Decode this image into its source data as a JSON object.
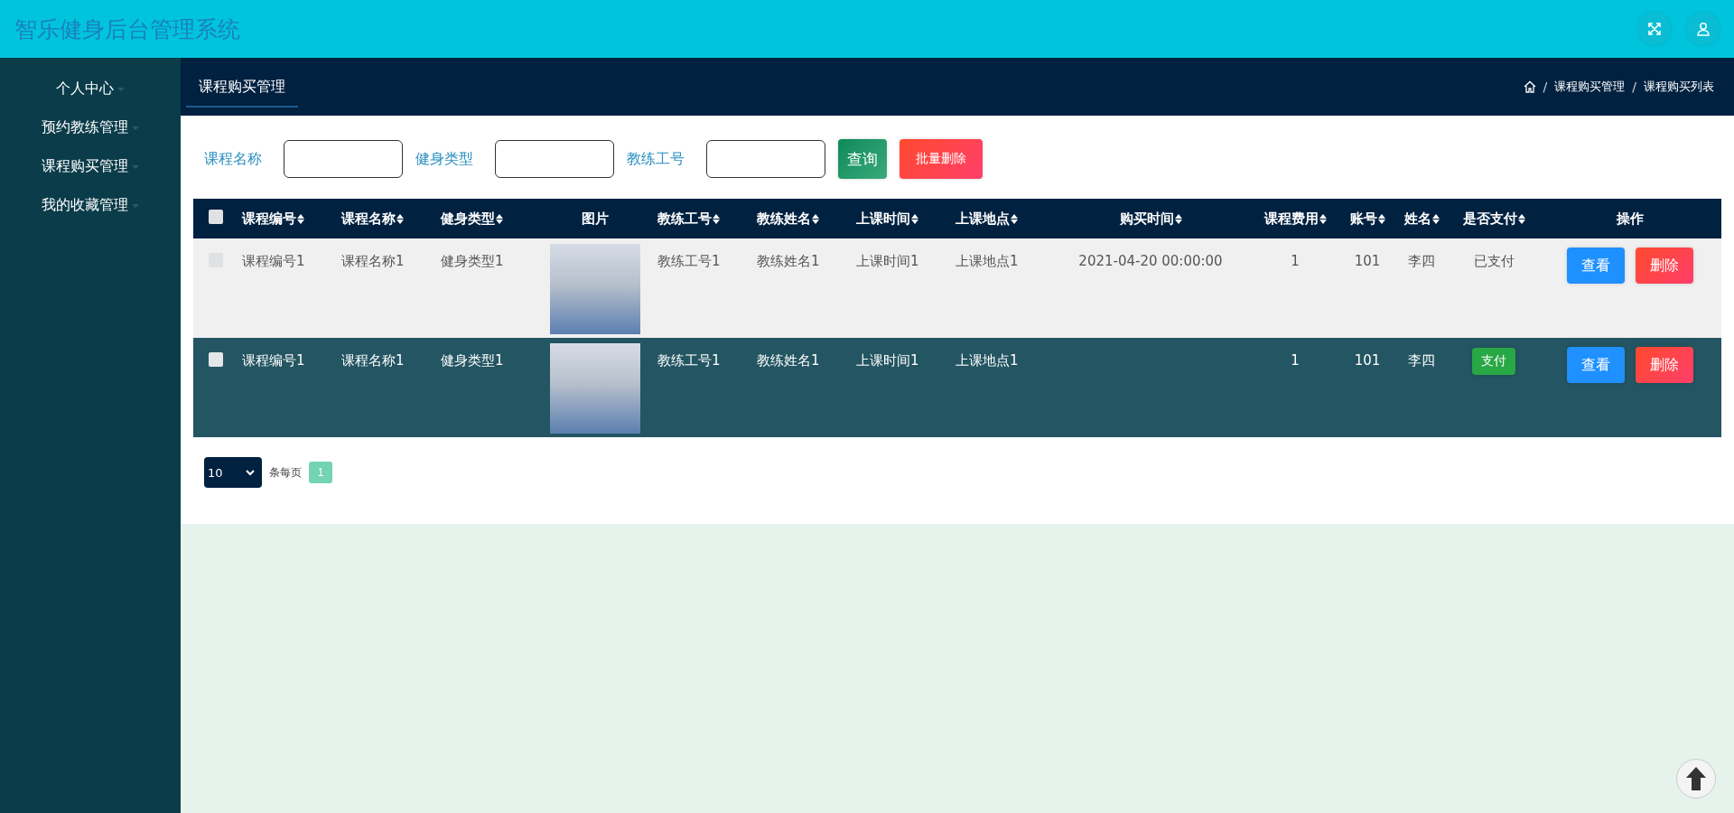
{
  "header": {
    "title": "智乐健身后台管理系统"
  },
  "sidebar": {
    "items": [
      {
        "label": "个人中心"
      },
      {
        "label": "预约教练管理"
      },
      {
        "label": "课程购买管理"
      },
      {
        "label": "我的收藏管理"
      }
    ]
  },
  "tab": {
    "label": "课程购买管理"
  },
  "breadcrumb": [
    {
      "kind": "separator",
      "label": "/"
    },
    {
      "kind": "link",
      "label": "课程购买管理"
    },
    {
      "kind": "separator",
      "label": "/"
    },
    {
      "kind": "link",
      "label": "课程购买列表"
    }
  ],
  "search": {
    "fields": [
      {
        "label": "课程名称"
      },
      {
        "label": "健身类型"
      },
      {
        "label": "教练工号"
      }
    ],
    "query_button": "查询",
    "batch_delete_button": "批量删除"
  },
  "table": {
    "select_all": {
      "checked": false
    },
    "columns": [
      {
        "label": "课程编号",
        "sortable": true
      },
      {
        "label": "课程名称",
        "sortable": true
      },
      {
        "label": "健身类型",
        "sortable": true
      },
      {
        "label": "图片",
        "sortable": false
      },
      {
        "label": "教练工号",
        "sortable": true
      },
      {
        "label": "教练姓名",
        "sortable": true
      },
      {
        "label": "上课时间",
        "sortable": true
      },
      {
        "label": "上课地点",
        "sortable": true
      },
      {
        "label": "购买时间",
        "sortable": true
      },
      {
        "label": "课程费用",
        "sortable": true
      },
      {
        "label": "账号",
        "sortable": true
      },
      {
        "label": "姓名",
        "sortable": true
      },
      {
        "label": "是否支付",
        "sortable": true
      },
      {
        "label": "操作",
        "sortable": false
      }
    ],
    "rows": [
      {
        "selected": false,
        "checked": false,
        "cells": [
          "课程编号1",
          "课程名称1",
          "健身类型1",
          "",
          "教练工号1",
          "教练姓名1",
          "上课时间1",
          "上课地点1",
          "2021-04-20 00:00:00",
          "1",
          "101",
          "李四"
        ],
        "payment": {
          "kind": "text",
          "label": "已支付"
        },
        "actions": [
          "查看",
          "删除"
        ]
      },
      {
        "selected": true,
        "checked": false,
        "cells": [
          "课程编号1",
          "课程名称1",
          "健身类型1",
          "",
          "教练工号1",
          "教练姓名1",
          "上课时间1",
          "上课地点1",
          "",
          "1",
          "101",
          "李四"
        ],
        "payment": {
          "kind": "button",
          "label": "支付"
        },
        "actions": [
          "查看",
          "删除"
        ]
      }
    ]
  },
  "pagination": {
    "page_size": "10",
    "page_size_label": "条每页",
    "pages": [
      {
        "label": "1",
        "selected": true
      }
    ]
  }
}
